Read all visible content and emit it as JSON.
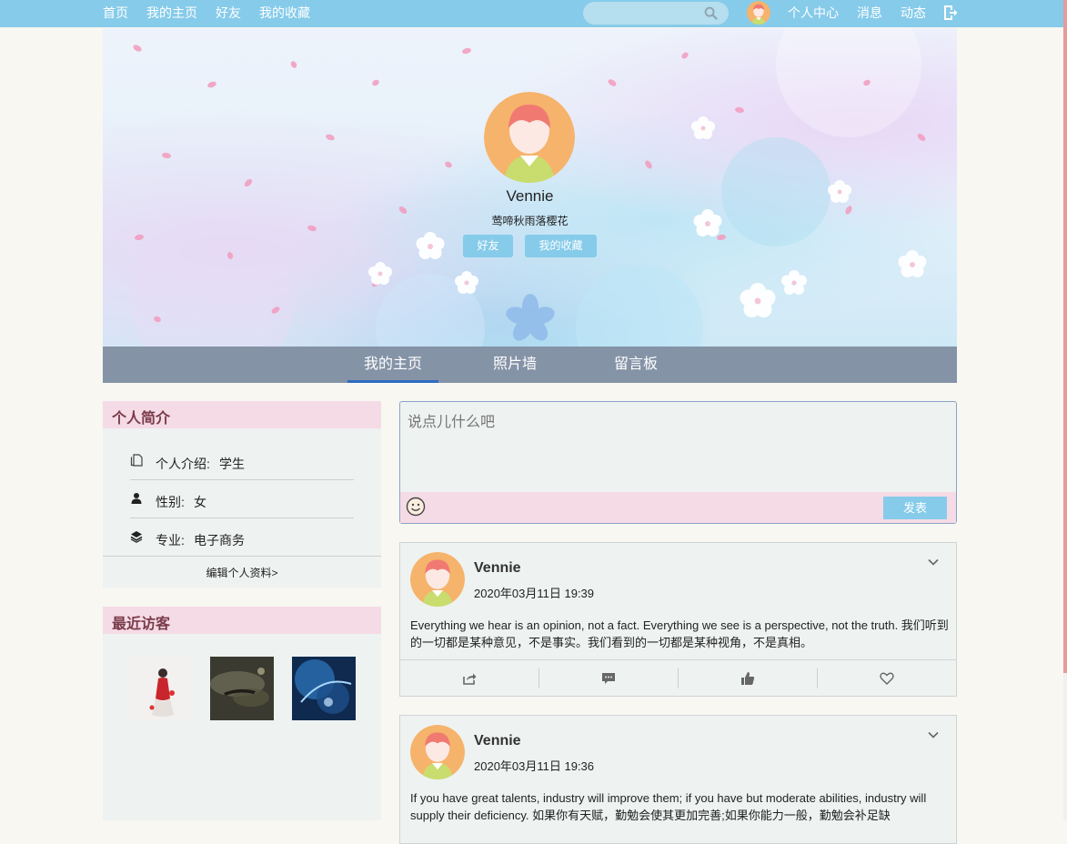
{
  "nav": {
    "links": [
      "首页",
      "我的主页",
      "好友",
      "我的收藏"
    ],
    "search_placeholder": "",
    "right_links": [
      "个人中心",
      "消息",
      "动态"
    ]
  },
  "profile": {
    "name": "Vennie",
    "motto": "莺啼秋雨落樱花",
    "buttons": [
      "好友",
      "我的收藏"
    ]
  },
  "tabs": [
    "我的主页",
    "照片墙",
    "留言板"
  ],
  "about": {
    "title": "个人简介",
    "rows": [
      {
        "icon": "document-icon",
        "label": "个人介绍:",
        "value": "学生"
      },
      {
        "icon": "person-icon",
        "label": "性别:",
        "value": "女"
      },
      {
        "icon": "layers-icon",
        "label": "专业:",
        "value": "电子商务"
      }
    ],
    "edit_link": "编辑个人资料>"
  },
  "visitors": {
    "title": "最近访客"
  },
  "composer": {
    "placeholder": "说点儿什么吧",
    "submit": "发表"
  },
  "posts": [
    {
      "author": "Vennie",
      "time": "2020年03月11日 19:39",
      "text": "Everything we hear is an opinion, not a fact. Everything we see is a perspective, not the truth. 我们听到的一切都是某种意见，不是事实。我们看到的一切都是某种视角，不是真相。"
    },
    {
      "author": "Vennie",
      "time": "2020年03月11日 19:36",
      "text": "If you have great talents, industry will improve them; if you have but moderate abilities, industry will supply their deficiency. 如果你有天赋，勤勉会使其更加完善;如果你能力一般，勤勉会补足缺"
    }
  ],
  "colors": {
    "nav_bg": "#86cbea",
    "tab_bg": "#8593a7",
    "card_header": "#f5dbe6",
    "card_title": "#7a3b4a",
    "accent": "#2e6cc2"
  }
}
